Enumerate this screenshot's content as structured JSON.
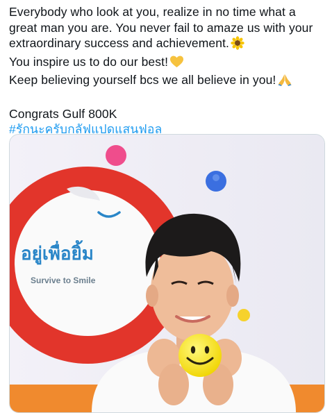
{
  "tweet": {
    "lines": [
      "Everybody who look at you, realize in no time what a",
      "great man you are. You never fail to amaze us with your",
      "extraordinary success and achievement.",
      "You inspire us to do our best!",
      "Keep believing yourself bcs we all believe in you!"
    ],
    "congrats": "Congrats Gulf 800K",
    "hashtag": "#รักนะครับกลัฟแปดแสนฟอล",
    "emojis": [
      "sunflower-emoji",
      "yellow-heart-emoji",
      "folded-hands-emoji"
    ]
  },
  "media": {
    "logo_thai": "อยู่เพื่อยิ้ม",
    "logo_tagline": "Survive to Smile"
  },
  "colors": {
    "text": "#0f1419",
    "hashtag": "#1d9bf0",
    "sign_red": "#e2352b",
    "smiley_yellow": "#f5e221"
  }
}
